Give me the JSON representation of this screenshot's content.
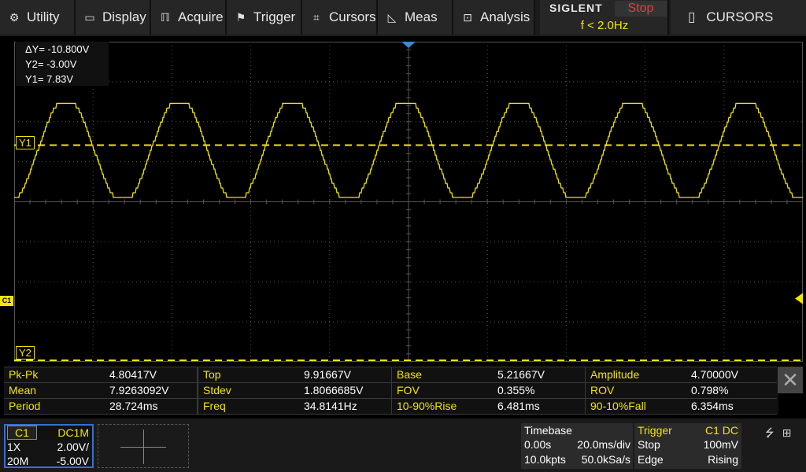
{
  "menu": {
    "items": [
      {
        "label": "Utility",
        "icon": "gear-icon",
        "glyph": "⚙",
        "width": 96
      },
      {
        "label": "Display",
        "icon": "monitor-icon",
        "glyph": "▭",
        "width": 96
      },
      {
        "label": "Acquire",
        "icon": "acquire-icon",
        "glyph": "ℿ",
        "width": 96
      },
      {
        "label": "Trigger",
        "icon": "flag-icon",
        "glyph": "⚑",
        "width": 96
      },
      {
        "label": "Cursors",
        "icon": "crosshair-icon",
        "glyph": "⌗",
        "width": 96
      },
      {
        "label": "Meas",
        "icon": "ruler-icon",
        "glyph": "◺",
        "width": 96
      },
      {
        "label": "Analysis",
        "icon": "analysis-icon",
        "glyph": "⊡",
        "width": 104
      }
    ]
  },
  "brand": {
    "logo": "SIGLENT",
    "run_state": "Stop",
    "trigger_freq": "f < 2.0Hz"
  },
  "mode": {
    "icon": "battery-icon",
    "glyph": "▯",
    "label": "CURSORS"
  },
  "cursor_readout": {
    "delta_y": "ΔY= -10.800V",
    "y2": "Y2= -3.00V",
    "y1": "Y1= 7.83V"
  },
  "cursor_labels": {
    "y1": "Y1",
    "y2": "Y2"
  },
  "channel_marker": "C1",
  "colors": {
    "trace": "#f2e600",
    "grid": "#555555",
    "accent": "#3a6fd0"
  },
  "waveform": {
    "period_ms": 28.724,
    "top_v": 9.91667,
    "base_v": 5.21667,
    "volts_per_div": 2.0,
    "offset_v": -5.0,
    "time_per_div_ms": 20.0,
    "y1_v": 7.83,
    "y2_v": -3.0
  },
  "measurements": [
    [
      {
        "name": "Pk-Pk",
        "value": "4.80417V"
      },
      {
        "name": "Top",
        "value": "9.91667V"
      },
      {
        "name": "Base",
        "value": "5.21667V"
      },
      {
        "name": "Amplitude",
        "value": "4.70000V"
      }
    ],
    [
      {
        "name": "Mean",
        "value": "7.9263092V"
      },
      {
        "name": "Stdev",
        "value": "1.8066685V"
      },
      {
        "name": "FOV",
        "value": "0.355%"
      },
      {
        "name": "ROV",
        "value": "0.798%"
      }
    ],
    [
      {
        "name": "Period",
        "value": "28.724ms"
      },
      {
        "name": "Freq",
        "value": "34.8141Hz"
      },
      {
        "name": "10-90%Rise",
        "value": "6.481ms"
      },
      {
        "name": "90-10%Fall",
        "value": "6.354ms"
      }
    ]
  ],
  "channel1": {
    "name": "C1",
    "coupling": "DC1M",
    "probe": "1X",
    "scale": "2.00V/",
    "bw": "20M",
    "offset": "-5.00V"
  },
  "timebase": {
    "title": "Timebase",
    "delay": "0.00s",
    "scale": "20.0ms/div",
    "points": "10.0kpts",
    "rate": "50.0kSa/s"
  },
  "trigger": {
    "title": "Trigger",
    "source": "C1 DC",
    "mode": "Stop",
    "level": "100mV",
    "type": "Edge",
    "slope": "Rising"
  }
}
